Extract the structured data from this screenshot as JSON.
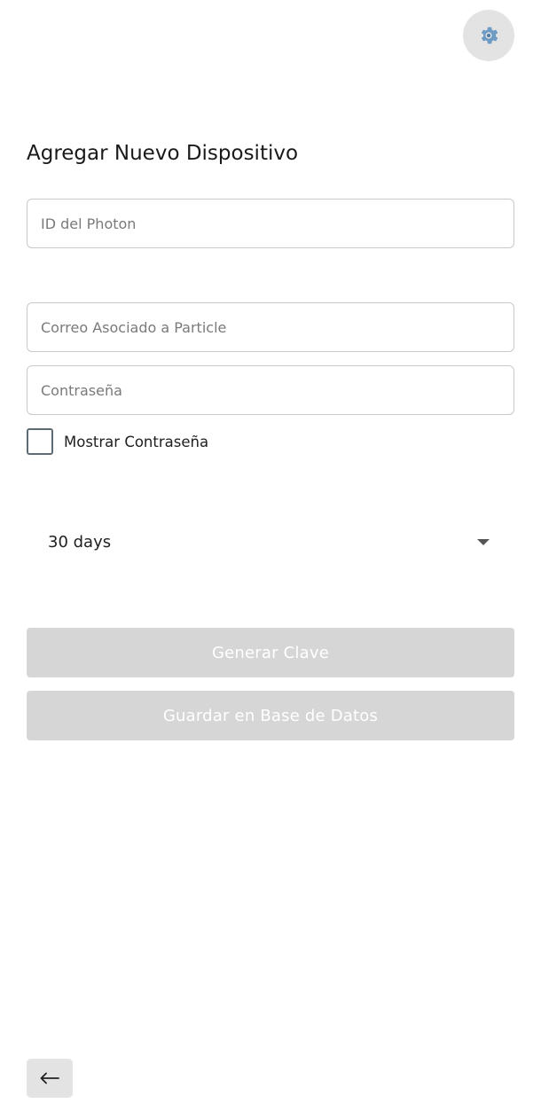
{
  "header": {
    "settings_icon": "gear-icon"
  },
  "form": {
    "title": "Agregar Nuevo Dispositivo",
    "photon_id": {
      "placeholder": "ID del Photon",
      "value": ""
    },
    "email": {
      "placeholder": "Correo Asociado a Particle",
      "value": ""
    },
    "password": {
      "placeholder": "Contraseña",
      "value": ""
    },
    "show_password": {
      "label": "Mostrar Contraseña",
      "checked": false
    },
    "duration": {
      "selected": "30 days"
    },
    "generate_button": "Generar Clave",
    "save_button": "Guardar en Base de Datos"
  },
  "footer": {
    "back_icon": "arrow-left-icon"
  },
  "colors": {
    "disabled_button": "#d6d6d6",
    "control_gray": "#e3e3e3",
    "checkbox_border": "#5f6b73"
  }
}
